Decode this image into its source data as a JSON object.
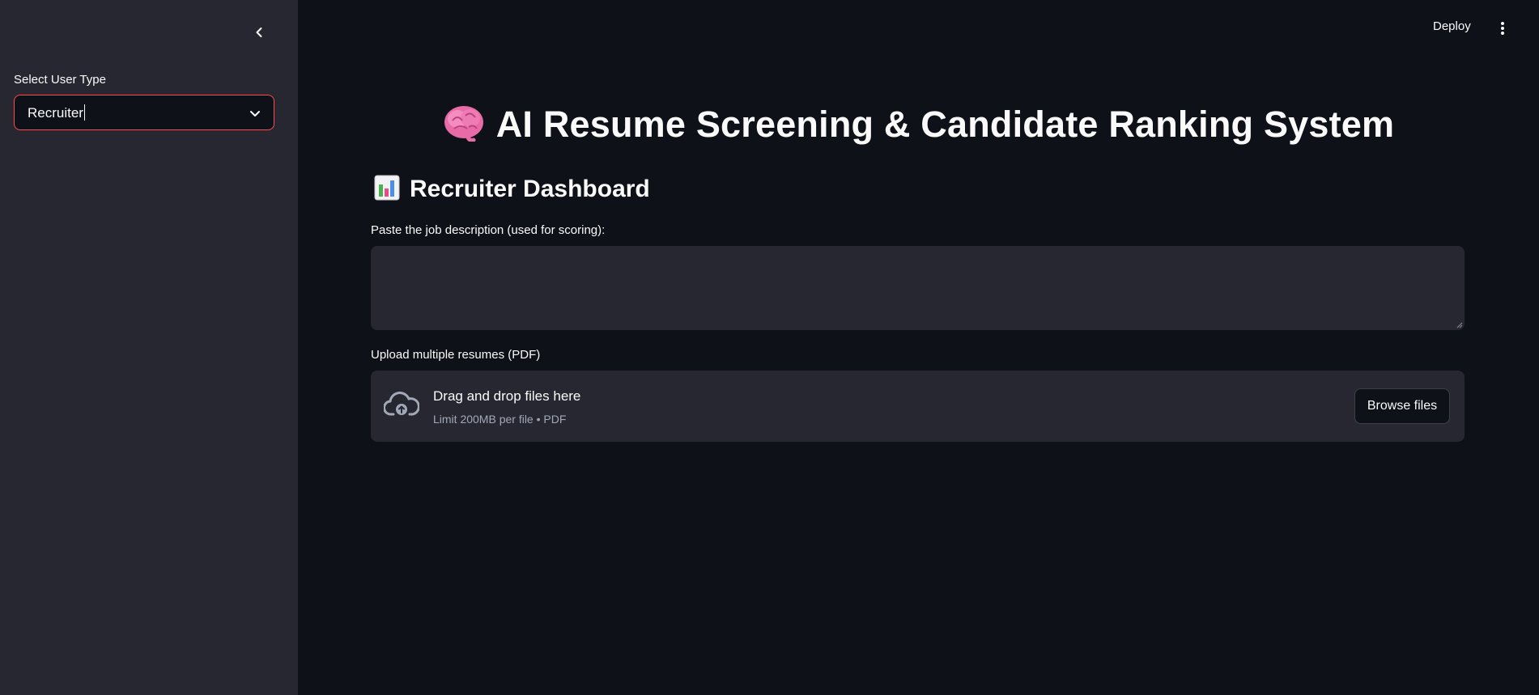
{
  "sidebar": {
    "select_label": "Select User Type",
    "selected_value": "Recruiter"
  },
  "header": {
    "deploy_label": "Deploy"
  },
  "main": {
    "title": "AI Resume Screening & Candidate Ranking System",
    "dashboard_title": "Recruiter Dashboard",
    "jd_label": "Paste the job description (used for scoring):",
    "jd_value": "",
    "upload_label": "Upload multiple resumes (PDF)",
    "upload_main_text": "Drag and drop files here",
    "upload_sub_text": "Limit 200MB per file • PDF",
    "browse_label": "Browse files"
  },
  "icons": {
    "title_icon": "brain-icon",
    "dashboard_icon": "bar-chart-icon",
    "collapse_icon": "chevron-left-icon",
    "select_icon": "chevron-down-icon",
    "menu_icon": "more-vertical-icon",
    "upload_icon": "cloud-upload-icon"
  },
  "colors": {
    "background": "#0e1117",
    "sidebar": "#262730",
    "accent": "#ff4b4b",
    "muted_text": "#a3a8b8"
  }
}
